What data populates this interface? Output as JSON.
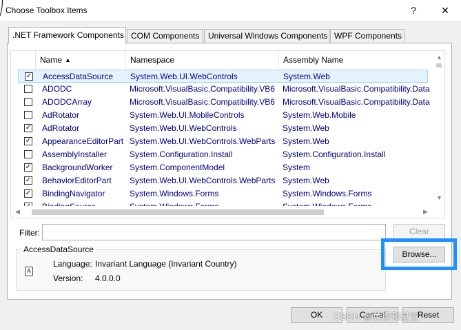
{
  "window": {
    "title": "Choose Toolbox Items",
    "help_label": "?",
    "close_label": "✕"
  },
  "tabs": [
    {
      "label": ".NET Framework Components",
      "active": true
    },
    {
      "label": "COM Components",
      "active": false
    },
    {
      "label": "Universal Windows Components",
      "active": false
    },
    {
      "label": "WPF Components",
      "active": false
    }
  ],
  "list": {
    "columns": [
      "Name",
      "Namespace",
      "Assembly Name"
    ],
    "sort_indicator": "▲",
    "rows": [
      {
        "checked": true,
        "name": "AccessDataSource",
        "namespace": "System.Web.UI.WebControls",
        "assembly": "System.Web",
        "selected": true
      },
      {
        "checked": false,
        "name": "ADODC",
        "namespace": "Microsoft.VisualBasic.Compatibility.VB6",
        "assembly": "Microsoft.VisualBasic.Compatibility.Data"
      },
      {
        "checked": false,
        "name": "ADODCArray",
        "namespace": "Microsoft.VisualBasic.Compatibility.VB6",
        "assembly": "Microsoft.VisualBasic.Compatibility.Data"
      },
      {
        "checked": false,
        "name": "AdRotator",
        "namespace": "System.Web.UI.MobileControls",
        "assembly": "System.Web.Mobile"
      },
      {
        "checked": true,
        "name": "AdRotator",
        "namespace": "System.Web.UI.WebControls",
        "assembly": "System.Web"
      },
      {
        "checked": true,
        "name": "AppearanceEditorPart",
        "namespace": "System.Web.UI.WebControls.WebParts",
        "assembly": "System.Web"
      },
      {
        "checked": false,
        "name": "AssemblyInstaller",
        "namespace": "System.Configuration.Install",
        "assembly": "System.Configuration.Install"
      },
      {
        "checked": true,
        "name": "BackgroundWorker",
        "namespace": "System.ComponentModel",
        "assembly": "System"
      },
      {
        "checked": true,
        "name": "BehaviorEditorPart",
        "namespace": "System.Web.UI.WebControls.WebParts",
        "assembly": "System.Web"
      },
      {
        "checked": true,
        "name": "BindingNavigator",
        "namespace": "System.Windows.Forms",
        "assembly": "System.Windows.Forms"
      },
      {
        "checked": true,
        "name": "BindingSource",
        "namespace": "System.Windows.Forms",
        "assembly": "System.Windows.Forms"
      }
    ]
  },
  "filter": {
    "label": "Filter:",
    "value": "",
    "clear_label": "Clear"
  },
  "details": {
    "group_title": "AccessDataSource",
    "language_label": "Language:",
    "language_value": "Invariant Language (Invariant Country)",
    "version_label": "Version:",
    "version_value": "4.0.0.0",
    "icon_glyph": "A"
  },
  "browse_label": "Browse...",
  "footer": {
    "ok_label": "OK",
    "cancel_label": "Cancel",
    "reset_label": "Reset"
  },
  "watermark": "CSDN @黄昏和星空",
  "colors": {
    "accent_highlight": "#1e90ff",
    "list_text": "#000080",
    "selected_row": "#e5f3ff"
  }
}
